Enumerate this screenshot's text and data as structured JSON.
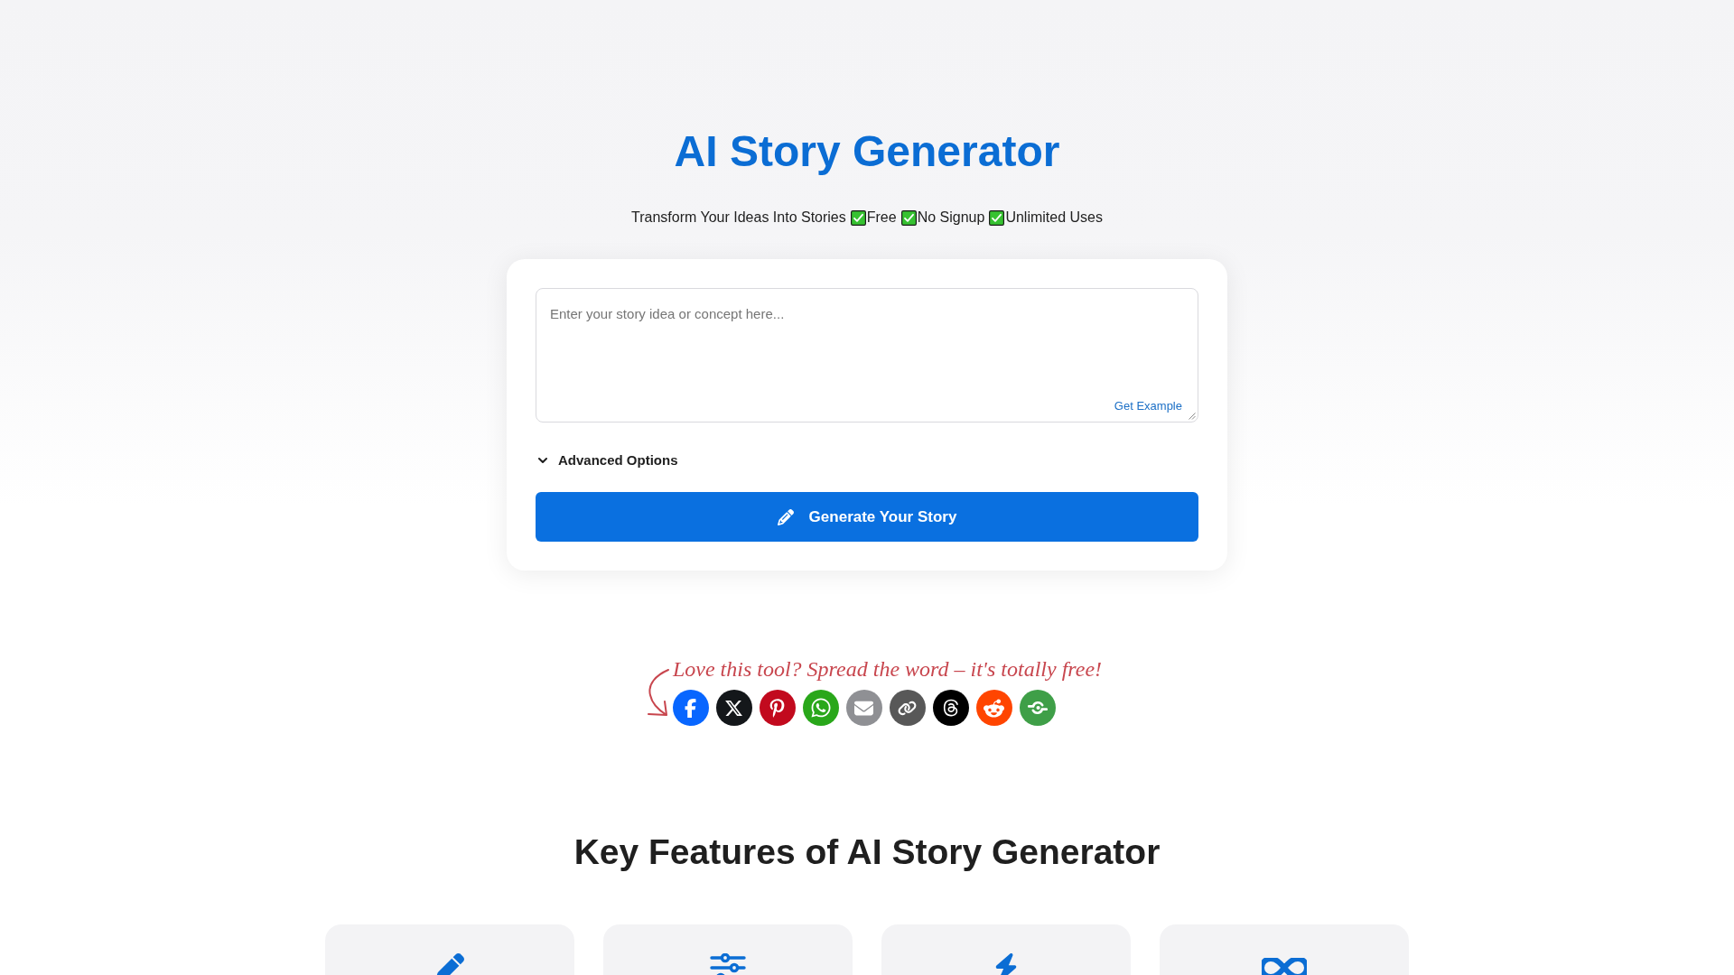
{
  "header": {
    "title": "AI Story Generator",
    "tagline": "Transform Your Ideas Into Stories",
    "perks": [
      "Free",
      "No Signup",
      "Unlimited Uses"
    ]
  },
  "story_form": {
    "input": {
      "placeholder": "Enter your story idea or concept here..."
    },
    "example_link": "Get Example",
    "advanced_options": {
      "label": "Advanced Options",
      "expanded": false
    },
    "submit_button": "Generate Your Story"
  },
  "share": {
    "prompt": "Love this tool? Spread the word – it's totally free!",
    "buttons": [
      {
        "kind": "facebook",
        "color": "#0866ff"
      },
      {
        "kind": "x",
        "color": "#14171a"
      },
      {
        "kind": "pinterest",
        "color": "#c20a1e"
      },
      {
        "kind": "whatsapp",
        "color": "#29a71a"
      },
      {
        "kind": "email",
        "color": "#8f9094"
      },
      {
        "kind": "link",
        "color": "#585858"
      },
      {
        "kind": "threads",
        "color": "#000000"
      },
      {
        "kind": "reddit",
        "color": "#ff4500"
      },
      {
        "kind": "more",
        "color": "#3f9f48"
      }
    ]
  },
  "features": {
    "title": "Key Features of AI Story Generator",
    "cards": [
      {
        "kind": "pen"
      },
      {
        "kind": "sliders"
      },
      {
        "kind": "bolt"
      },
      {
        "kind": "infinity"
      }
    ]
  }
}
